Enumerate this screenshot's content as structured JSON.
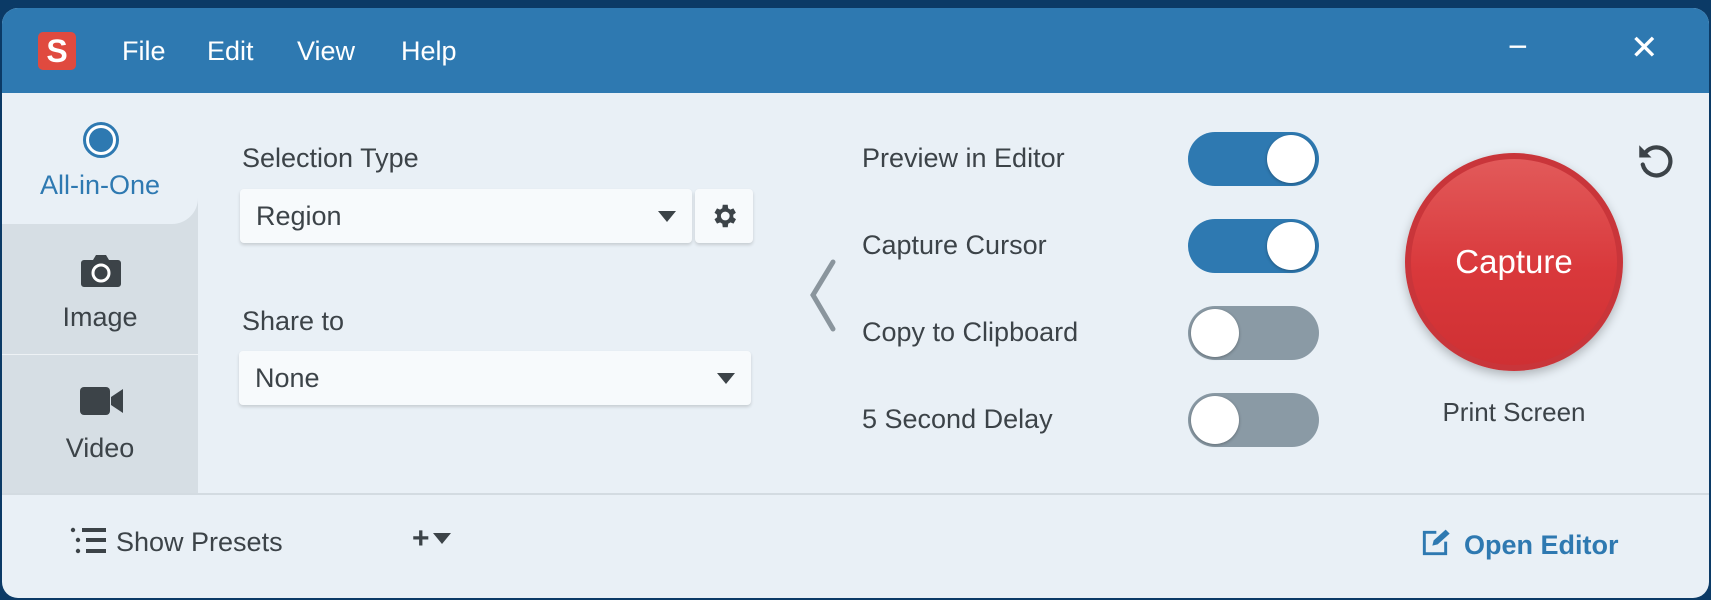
{
  "app": {
    "logo": "S",
    "menu": [
      "File",
      "Edit",
      "View",
      "Help"
    ]
  },
  "window_controls": {
    "minimize": "−",
    "close": "✕"
  },
  "tabs": [
    {
      "label": "All-in-One",
      "icon": "radio-circle-icon",
      "active": true
    },
    {
      "label": "Image",
      "icon": "camera-icon",
      "active": false
    },
    {
      "label": "Video",
      "icon": "video-camera-icon",
      "active": false
    }
  ],
  "selection_type": {
    "label": "Selection Type",
    "value": "Region"
  },
  "share_to": {
    "label": "Share to",
    "value": "None"
  },
  "toggles": [
    {
      "label": "Preview in Editor",
      "on": true
    },
    {
      "label": "Capture Cursor",
      "on": true
    },
    {
      "label": "Copy to Clipboard",
      "on": false
    },
    {
      "label": "5 Second Delay",
      "on": false
    }
  ],
  "capture": {
    "label": "Capture",
    "hotkey": "Print Screen"
  },
  "footer": {
    "show_presets": "Show Presets",
    "add": "+",
    "open_editor": "Open Editor"
  },
  "colors": {
    "accent": "#2e79b1",
    "capture": "#d9383b",
    "toggle_off": "#8a9aa5"
  }
}
